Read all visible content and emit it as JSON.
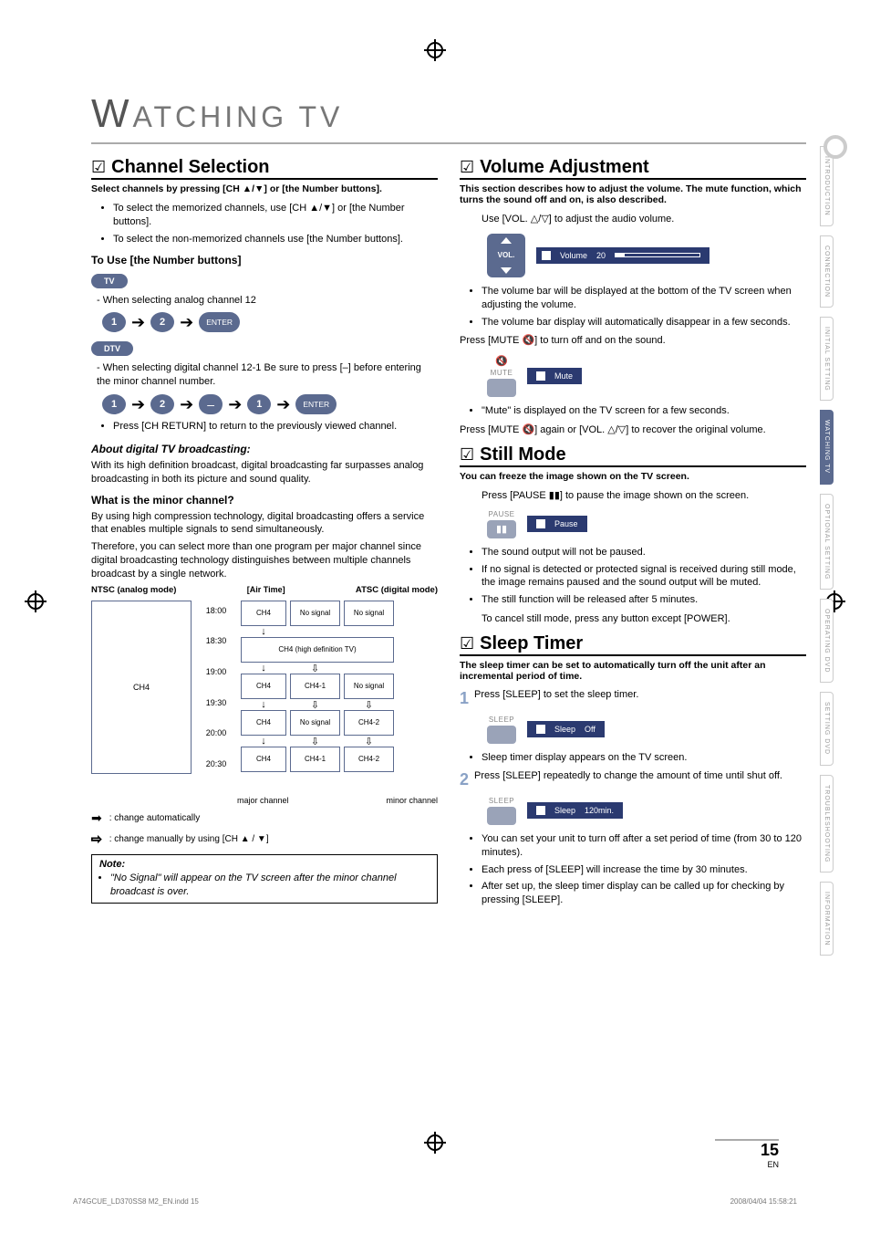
{
  "page": {
    "title_big": "W",
    "title_rest": "ATCHING   TV",
    "number": "15",
    "lang": "EN"
  },
  "channel": {
    "heading": "Channel Selection",
    "subtitle": "Select channels by pressing [CH ▲/▼] or [the Number buttons].",
    "memorized": "To select the memorized channels, use [CH ▲/▼] or [the Number buttons].",
    "nonmemorized": "To select the non-memorized channels use [the Number buttons].",
    "number_head": "To Use [the Number buttons]",
    "tv_pill": "TV",
    "analog_line": "When selecting analog channel 12",
    "seq_analog": {
      "b1": "1",
      "b2": "2",
      "enter": "ENTER"
    },
    "dtv_pill": "DTV",
    "digital_line": "When selecting digital channel 12-1 Be sure to press [–] before entering the minor channel number.",
    "seq_digital": {
      "b1": "1",
      "b2": "2",
      "dash": "–",
      "b3": "1",
      "enter": "ENTER"
    },
    "ch_return": "Press [CH RETURN] to return to the previously viewed channel.",
    "about_head": "About digital TV broadcasting:",
    "about_p": "With its high definition broadcast, digital broadcasting far surpasses analog broadcasting in both its picture and sound quality.",
    "minor_head": "What is the minor channel?",
    "minor_p1": "By using high compression technology, digital broadcasting offers a service that enables multiple signals to send simultaneously.",
    "minor_p2": "Therefore, you can select more than one program per major channel since digital broadcasting technology distinguishes between multiple channels broadcast by a single network.",
    "chart": {
      "ntsc_label": "NTSC (analog mode)",
      "airtime": "[Air Time]",
      "atsc_label": "ATSC (digital mode)",
      "times": [
        "18:00",
        "18:30",
        "19:00",
        "19:30",
        "20:00",
        "20:30"
      ],
      "ntsc_cell": "CH4",
      "atsc_hdtv": "CH4\n(high definition TV)",
      "major_label": "major channel",
      "minor_label": "minor channel"
    },
    "legend_auto": ": change automatically",
    "legend_manual": ": change manually by using [CH ▲ / ▼]",
    "note_title": "Note:",
    "note_item": "\"No Signal\" will appear on the TV screen after the minor channel broadcast is over."
  },
  "volume": {
    "heading": "Volume Adjustment",
    "subtitle": "This section describes how to adjust the volume. The mute function, which turns the sound off and on, is also described.",
    "use_line": "Use [VOL. △/▽] to adjust the audio volume.",
    "vol_btn_label": "VOL.",
    "osd_volume_label": "Volume",
    "osd_volume_value": "20",
    "b1": "The volume bar will be displayed at the bottom of the TV screen when adjusting the volume.",
    "b2": "The volume bar display will automatically disappear in a few seconds.",
    "mute_press": "Press [MUTE 🔇] to turn off and on the sound.",
    "mute_btn_label": "MUTE",
    "osd_mute_label": "Mute",
    "mute_disp": "\"Mute\" is displayed on the TV screen for a few seconds.",
    "mute_recover": "Press [MUTE 🔇] again or [VOL. △/▽] to recover the original volume."
  },
  "still": {
    "heading": "Still Mode",
    "subtitle": "You can freeze the image shown on the TV screen.",
    "press": "Press [PAUSE ▮▮] to pause the image shown on the screen.",
    "btn_label": "PAUSE",
    "osd_label": "Pause",
    "b1": "The sound output will not be paused.",
    "b2": "If no signal is detected or protected signal is received during still mode, the image remains paused and the sound output will be muted.",
    "b3": "The still function will be released after 5 minutes.",
    "cancel": "To cancel still mode, press any button except [POWER]."
  },
  "sleep": {
    "heading": "Sleep Timer",
    "subtitle": "The sleep timer can be set to automatically turn off the unit after an incremental period of time.",
    "step1": "Press [SLEEP] to set the sleep timer.",
    "btn_label": "SLEEP",
    "osd_label": "Sleep",
    "osd_val_off": "Off",
    "b_step1": "Sleep timer display appears on the TV screen.",
    "step2": "Press [SLEEP] repeatedly to change the amount of time until shut off.",
    "osd_val_120": "120min.",
    "b1": "You can set your unit to turn off after a set period of time (from 30 to 120 minutes).",
    "b2": "Each press of [SLEEP] will increase the time by 30 minutes.",
    "b3": "After set up, the sleep timer display can be called up for checking by pressing [SLEEP]."
  },
  "sidetabs": [
    "INTRODUCTION",
    "CONNECTION",
    "INITIAL SETTING",
    "WATCHING TV",
    "OPTIONAL SETTING",
    "OPERATING DVD",
    "SETTING DVD",
    "TROUBLESHOOTING",
    "INFORMATION"
  ],
  "sidetab_active_index": 3,
  "footer": {
    "left": "A74GCUE_LD370SS8 M2_EN.indd   15",
    "right": "2008/04/04   15:58:21"
  }
}
